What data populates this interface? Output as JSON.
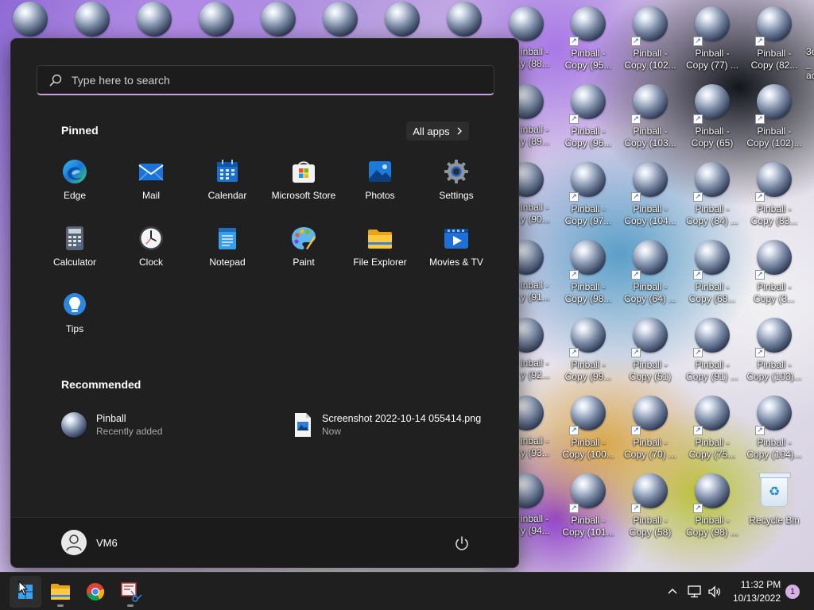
{
  "desktop": {
    "left_column_partial_labels": [
      "inball -",
      "y (88...",
      "inball -",
      "y (89...",
      "inball -",
      "y (90...",
      "inball -",
      "y (91...",
      "inball -",
      "y (92...",
      "inball -",
      "y (93...",
      "inball -",
      "y (94..."
    ],
    "column_1": [
      [
        "Pinball -",
        "Copy (95..."
      ],
      [
        "Pinball -",
        "Copy (96..."
      ],
      [
        "Pinball -",
        "Copy (97..."
      ],
      [
        "Pinball -",
        "Copy (98..."
      ],
      [
        "Pinball -",
        "Copy (99..."
      ],
      [
        "Pinball -",
        "Copy (100..."
      ],
      [
        "Pinball -",
        "Copy (101..."
      ]
    ],
    "column_2": [
      [
        "Pinball -",
        "Copy (102..."
      ],
      [
        "Pinball -",
        "Copy (103..."
      ],
      [
        "Pinball -",
        "Copy (104..."
      ],
      [
        "Pinball -",
        "Copy (64) ..."
      ],
      [
        "Pinball -",
        "Copy (51)"
      ],
      [
        "Pinball -",
        "Copy (70) ..."
      ],
      [
        "Pinball -",
        "Copy (58)"
      ]
    ],
    "column_3": [
      [
        "Pinball -",
        "Copy (77) ..."
      ],
      [
        "Pinball -",
        "Copy (65)"
      ],
      [
        "Pinball -",
        "Copy (84) ..."
      ],
      [
        "Pinball -",
        "Copy (68..."
      ],
      [
        "Pinball -",
        "Copy (91) ..."
      ],
      [
        "Pinball -",
        "Copy (75..."
      ],
      [
        "Pinball -",
        "Copy (98) ..."
      ]
    ],
    "column_4": [
      [
        "Pinball -",
        "Copy (82..."
      ],
      [
        "Pinball -",
        "Copy (102)..."
      ],
      [
        "Pinball -",
        "Copy (83..."
      ],
      [
        "Pinball -",
        "Copy (3..."
      ],
      [
        "Pinball -",
        "Copy (103)..."
      ],
      [
        "Pinball -",
        "Copy (104)..."
      ]
    ],
    "recycle_bin_label": "Recycle Bin",
    "edge_partial": [
      "3e",
      "_",
      "ac"
    ]
  },
  "start_menu": {
    "search_placeholder": "Type here to search",
    "pinned_title": "Pinned",
    "all_apps_label": "All apps",
    "pinned_apps": [
      {
        "label": "Edge",
        "icon": "edge-icon"
      },
      {
        "label": "Mail",
        "icon": "mail-icon"
      },
      {
        "label": "Calendar",
        "icon": "calendar-icon"
      },
      {
        "label": "Microsoft Store",
        "icon": "store-icon"
      },
      {
        "label": "Photos",
        "icon": "photos-icon"
      },
      {
        "label": "Settings",
        "icon": "settings-icon"
      },
      {
        "label": "Calculator",
        "icon": "calculator-icon"
      },
      {
        "label": "Clock",
        "icon": "clock-icon"
      },
      {
        "label": "Notepad",
        "icon": "notepad-icon"
      },
      {
        "label": "Paint",
        "icon": "paint-icon"
      },
      {
        "label": "File Explorer",
        "icon": "file-explorer-icon"
      },
      {
        "label": "Movies & TV",
        "icon": "movies-tv-icon"
      },
      {
        "label": "Tips",
        "icon": "tips-icon"
      }
    ],
    "recommended_title": "Recommended",
    "recommended": [
      {
        "name": "Pinball",
        "sub": "Recently added"
      },
      {
        "name": "Screenshot 2022-10-14 055414.png",
        "sub": "Now"
      }
    ],
    "user_name": "VM6"
  },
  "taskbar": {
    "time": "11:32 PM",
    "date": "10/13/2022",
    "notification_count": "1"
  },
  "colors": {
    "accent": "#c9a1d6",
    "menu_bg": "#202020",
    "taskbar_bg": "#1f1f1f"
  }
}
